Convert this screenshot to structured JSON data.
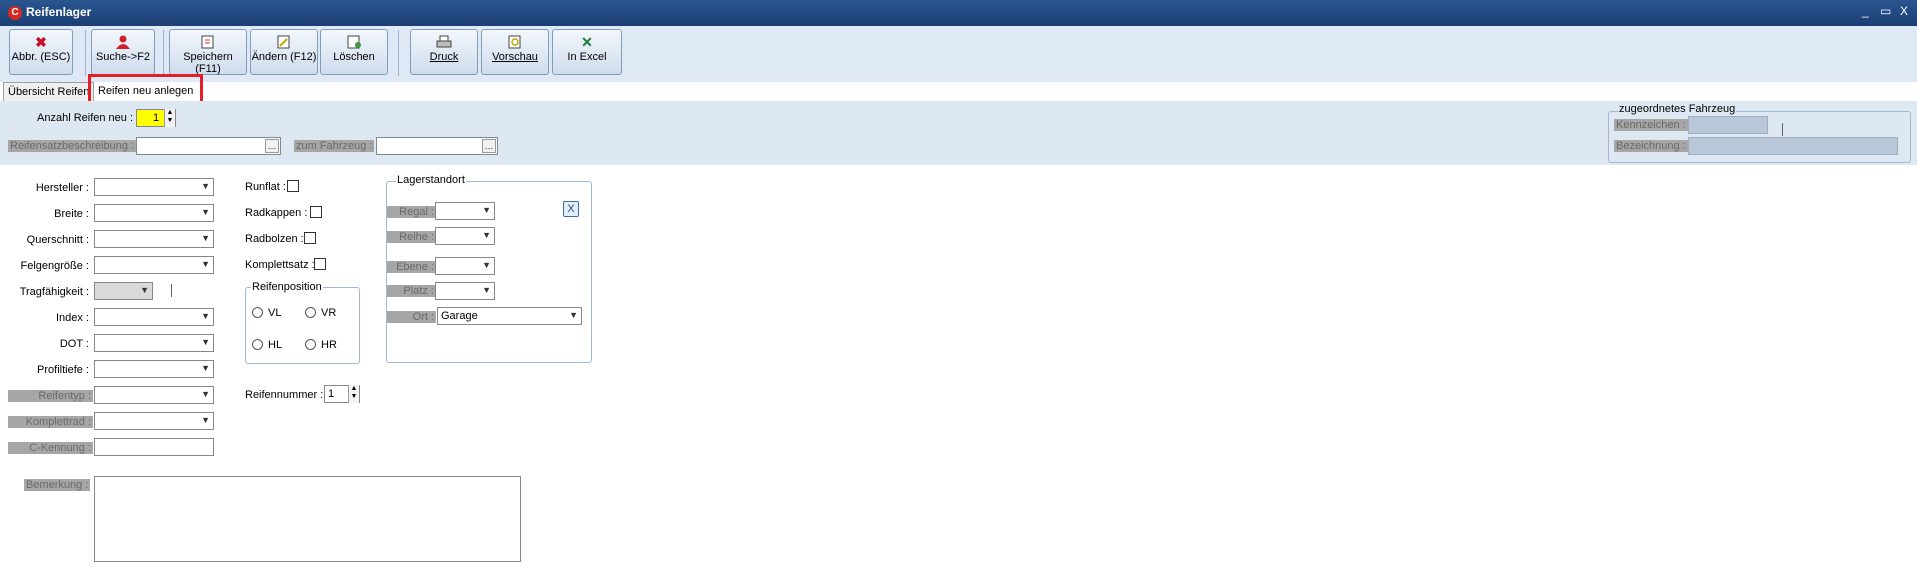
{
  "window": {
    "title": "Reifenlager",
    "logo_letter": "C",
    "minimize": "_",
    "restore": "▭",
    "close": "X"
  },
  "toolbar": {
    "cancel": "Abbr. (ESC)",
    "search": "Suche->F2",
    "save": "Speichern (F11)",
    "edit": "Ändern (F12)",
    "delete": "Löschen",
    "print": "Druck",
    "preview": "Vorschau",
    "excel": "In Excel"
  },
  "tabs": {
    "overview": "Übersicht Reifen",
    "new": "Reifen neu anlegen"
  },
  "header": {
    "count_label": "Anzahl Reifen neu :",
    "count_value": "1",
    "set_desc_label": "Reifensatzbeschreibung :",
    "vehicle_label": "zum Fahrzeug :",
    "assigned_vehicle": {
      "title": "zugeordnetes Fahrzeug",
      "plate_label": "Kennzeichen :",
      "designation_label": "Bezeichnung :"
    }
  },
  "form": {
    "manufacturer": "Hersteller :",
    "width": "Breite :",
    "cross_section": "Querschnitt :",
    "rim_size": "Felgengröße :",
    "load_capacity": "Tragfähigkeit :",
    "index": "Index :",
    "dot": "DOT :",
    "tread_depth": "Profiltiefe :",
    "tire_type": "Reifentyp :",
    "complete_wheel": "Komplettrad :",
    "c_marking": "C-Kennung :",
    "remark": "Bemerkung :",
    "runflat": "Runflat :",
    "hubcaps": "Radkappen :",
    "wheel_bolts": "Radbolzen :",
    "complete_set": "Komplettsatz :",
    "tire_position": {
      "title": "Reifenposition",
      "vl": "VL",
      "vr": "VR",
      "hl": "HL",
      "hr": "HR"
    },
    "tire_number_label": "Reifennummer :",
    "tire_number_value": "1"
  },
  "storage": {
    "title": "Lagerstandort",
    "shelf": "Regal :",
    "row": "Reihe :",
    "level": "Ebene :",
    "slot": "Platz :",
    "location": "Ort :",
    "location_value": "Garage",
    "clear_button": "X"
  },
  "icons": {
    "cancel": "red-x-icon",
    "search": "person-icon",
    "save": "save-icon",
    "edit": "edit-icon",
    "delete": "delete-icon",
    "print": "printer-icon",
    "preview": "preview-icon",
    "excel": "excel-icon"
  },
  "colors": {
    "highlight": "#ffff00",
    "title_bar": "#1b3f74",
    "band": "#dde8f3",
    "focus_box": "#e31e24"
  }
}
